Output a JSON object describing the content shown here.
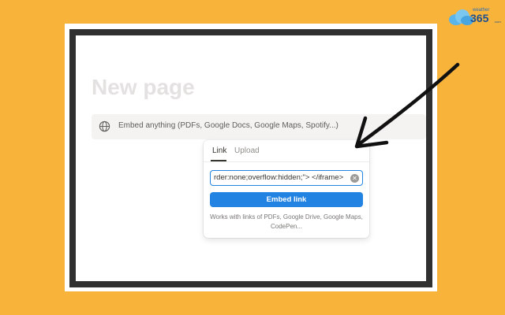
{
  "logo": {
    "small_text": "weather",
    "big_text": "365",
    "dotcom": ".com"
  },
  "page": {
    "title": "New page"
  },
  "embed_bar": {
    "placeholder_text": "Embed anything (PDFs, Google Docs, Google Maps, Spotify...)",
    "icon": "globe-icon"
  },
  "popover": {
    "tabs": [
      {
        "label": "Link",
        "active": true
      },
      {
        "label": "Upload",
        "active": false
      }
    ],
    "url_value": "rder:none;overflow:hidden;\"> </iframe>",
    "clear_icon": "close-circle-icon",
    "button_label": "Embed link",
    "help_text_line1": "Works with links of PDFs, Google Drive, Google Maps,",
    "help_text_line2": "CodePen..."
  },
  "colors": {
    "background": "#F8B33B",
    "accent": "#2383e2",
    "frame": "#303030"
  }
}
